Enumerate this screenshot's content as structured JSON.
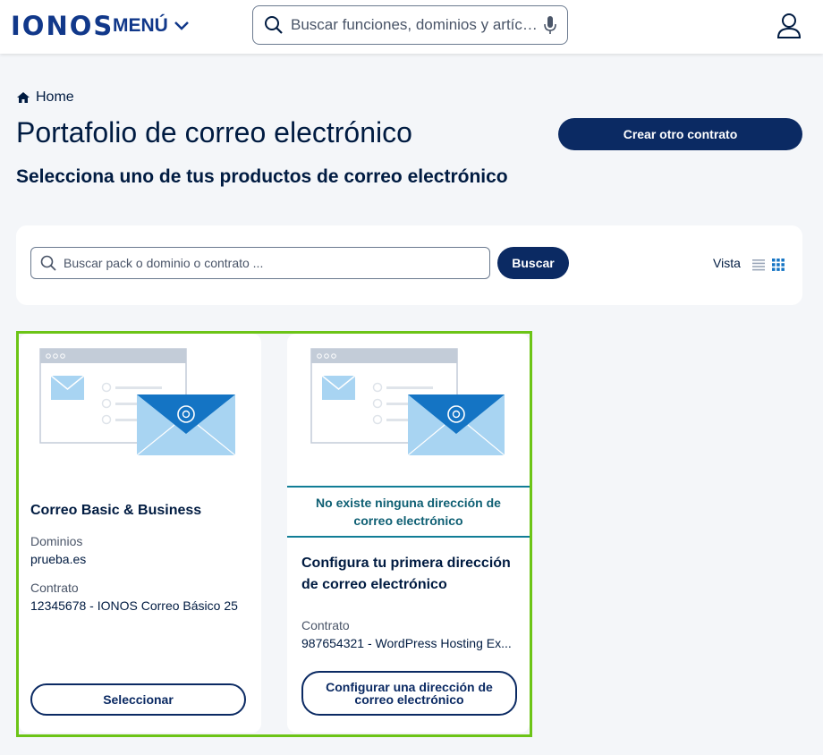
{
  "header": {
    "logo": "IONOS",
    "menu_label": "MENÚ",
    "search_placeholder": "Buscar funciones, dominios y artículos"
  },
  "breadcrumb": {
    "home": "Home"
  },
  "page": {
    "title": "Portafolio de correo electrónico",
    "subtitle": "Selecciona uno de tus productos de correo electrónico",
    "create_button": "Crear otro contrato"
  },
  "filter": {
    "placeholder": "Buscar pack o dominio o contrato ...",
    "search_button": "Buscar",
    "view_label": "Vista"
  },
  "cards": [
    {
      "title": "Correo Basic & Business",
      "domains_label": "Dominios",
      "domains_value": "prueba.es",
      "contract_label": "Contrato",
      "contract_value": "12345678 - IONOS Correo Básico 25",
      "button": "Seleccionar"
    },
    {
      "notice": "No existe ninguna dirección de correo electrónico",
      "title": "Configura tu primera dirección de correo electrónico",
      "contract_label": "Contrato",
      "contract_value": "987654321 - WordPress Hosting Ex...",
      "button": "Configurar una dirección de correo electrónico"
    }
  ],
  "colors": {
    "brand": "#11388a",
    "primary_button": "#0b2a63",
    "highlight": "#6cc417",
    "notice": "#117d96"
  }
}
